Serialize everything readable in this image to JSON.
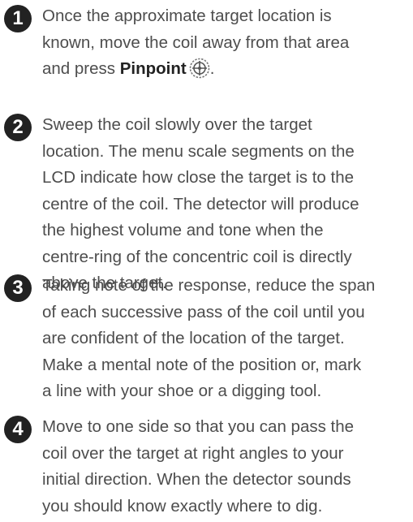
{
  "steps": [
    {
      "number": "1",
      "lines": [
        "Once the approximate target location is",
        "known, move the coil away from that area"
      ],
      "last_line_prefix": "and press ",
      "keyword": "Pinpoint",
      "icon": "pinpoint-icon",
      "last_line_suffix": "."
    },
    {
      "number": "2",
      "lines": [
        "Sweep the coil slowly over the target",
        "location. The menu scale segments on the",
        "LCD indicate how close the target is to the",
        "centre of the coil. The detector will produce",
        "the highest volume and tone when the",
        "centre-ring of the concentric coil is directly",
        "above the target."
      ]
    },
    {
      "number": "3",
      "lines": [
        "Taking note of the response, reduce the span",
        "of each successive pass of the coil until you",
        "are confident of the location of the target.",
        "Make a mental note of the position or, mark",
        "a line with your shoe or a digging tool."
      ]
    },
    {
      "number": "4",
      "lines": [
        "Move to one side so that you can pass the",
        "coil over the target at right angles to your",
        "initial direction. When the detector sounds",
        "you should know exactly where to dig."
      ]
    }
  ]
}
